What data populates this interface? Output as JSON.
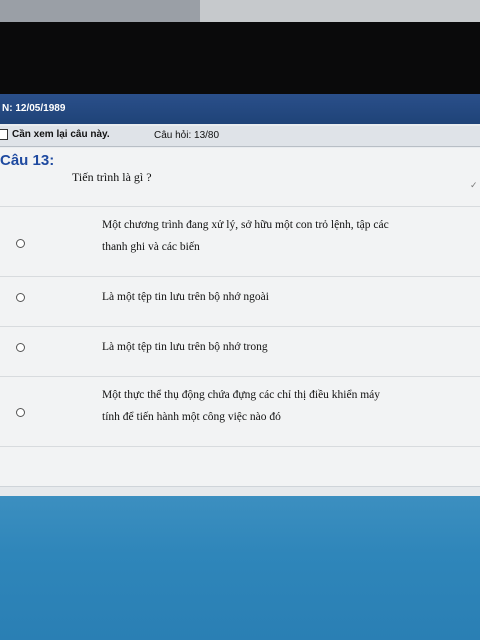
{
  "header": {
    "text": "N: 12/05/1989"
  },
  "toolbar": {
    "review_label": "Cần xem lại câu này.",
    "question_count": "Câu hỏi: 13/80"
  },
  "question": {
    "title": "Câu 13:",
    "text": "Tiến trình là gì ?",
    "options": [
      {
        "line1": "Một chương trình đang xử lý, sở hữu một con trỏ lệnh, tập các",
        "line2": "thanh ghi và các biến"
      },
      {
        "line1": "Là một tệp tin lưu trên bộ nhớ ngoài",
        "line2": ""
      },
      {
        "line1": "Là một tệp tin lưu trên bộ nhớ trong",
        "line2": ""
      },
      {
        "line1": "Một thực thể thụ động chứa đựng các chỉ thị điều khiển máy",
        "line2": "tính để tiến hành một công việc nào đó"
      }
    ]
  }
}
